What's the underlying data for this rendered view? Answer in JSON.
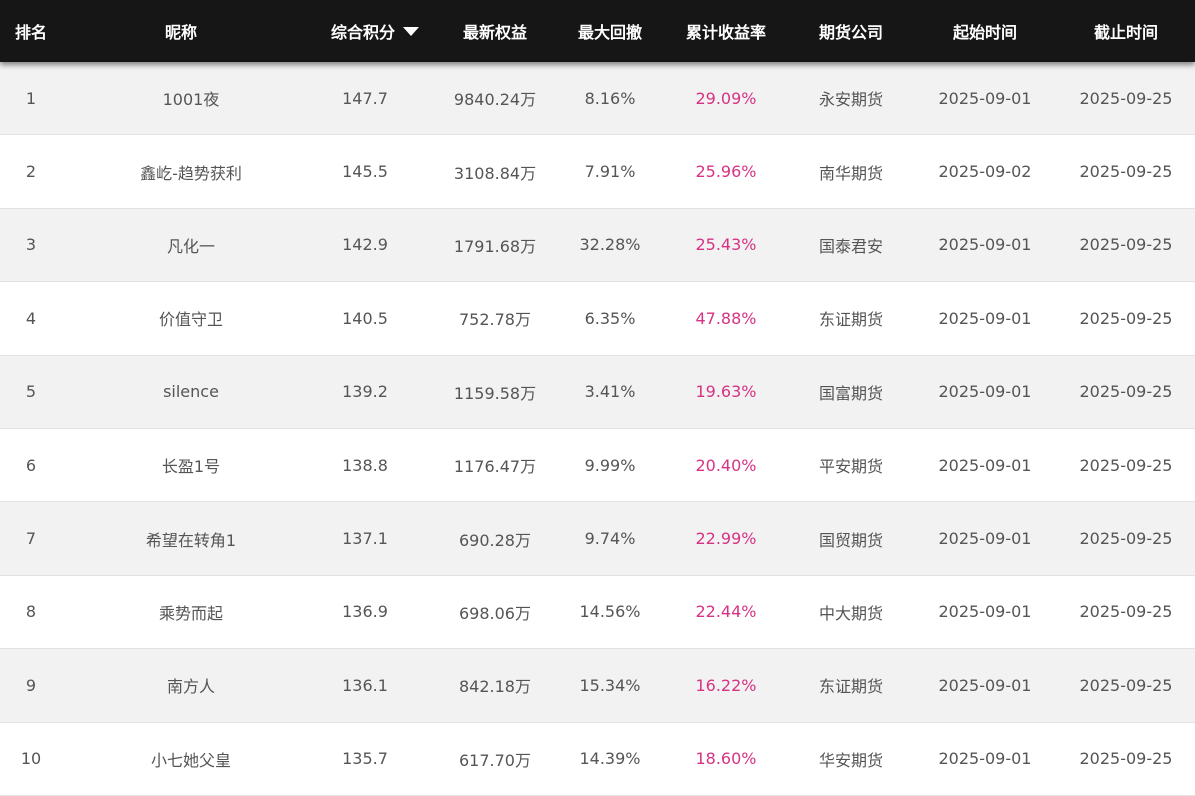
{
  "columns": [
    "排名",
    "昵称",
    "综合积分",
    "最新权益",
    "最大回撤",
    "累计收益率",
    "期货公司",
    "起始时间",
    "截止时间"
  ],
  "sort_icon": "caret-down-icon",
  "accent_color": "#d63384",
  "rows": [
    {
      "rank": "1",
      "name": "1001夜",
      "score": "147.7",
      "equity": "9840.24万",
      "drawdown": "8.16%",
      "return": "29.09%",
      "company": "永安期货",
      "start": "2025-09-01",
      "end": "2025-09-25"
    },
    {
      "rank": "2",
      "name": "鑫屹-趋势获利",
      "score": "145.5",
      "equity": "3108.84万",
      "drawdown": "7.91%",
      "return": "25.96%",
      "company": "南华期货",
      "start": "2025-09-02",
      "end": "2025-09-25"
    },
    {
      "rank": "3",
      "name": "凡化一",
      "score": "142.9",
      "equity": "1791.68万",
      "drawdown": "32.28%",
      "return": "25.43%",
      "company": "国泰君安",
      "start": "2025-09-01",
      "end": "2025-09-25"
    },
    {
      "rank": "4",
      "name": "价值守卫",
      "score": "140.5",
      "equity": "752.78万",
      "drawdown": "6.35%",
      "return": "47.88%",
      "company": "东证期货",
      "start": "2025-09-01",
      "end": "2025-09-25"
    },
    {
      "rank": "5",
      "name": "silence",
      "score": "139.2",
      "equity": "1159.58万",
      "drawdown": "3.41%",
      "return": "19.63%",
      "company": "国富期货",
      "start": "2025-09-01",
      "end": "2025-09-25"
    },
    {
      "rank": "6",
      "name": "长盈1号",
      "score": "138.8",
      "equity": "1176.47万",
      "drawdown": "9.99%",
      "return": "20.40%",
      "company": "平安期货",
      "start": "2025-09-01",
      "end": "2025-09-25"
    },
    {
      "rank": "7",
      "name": "希望在转角1",
      "score": "137.1",
      "equity": "690.28万",
      "drawdown": "9.74%",
      "return": "22.99%",
      "company": "国贸期货",
      "start": "2025-09-01",
      "end": "2025-09-25"
    },
    {
      "rank": "8",
      "name": "乘势而起",
      "score": "136.9",
      "equity": "698.06万",
      "drawdown": "14.56%",
      "return": "22.44%",
      "company": "中大期货",
      "start": "2025-09-01",
      "end": "2025-09-25"
    },
    {
      "rank": "9",
      "name": "南方人",
      "score": "136.1",
      "equity": "842.18万",
      "drawdown": "15.34%",
      "return": "16.22%",
      "company": "东证期货",
      "start": "2025-09-01",
      "end": "2025-09-25"
    },
    {
      "rank": "10",
      "name": "小七她父皇",
      "score": "135.7",
      "equity": "617.70万",
      "drawdown": "14.39%",
      "return": "18.60%",
      "company": "华安期货",
      "start": "2025-09-01",
      "end": "2025-09-25"
    }
  ]
}
